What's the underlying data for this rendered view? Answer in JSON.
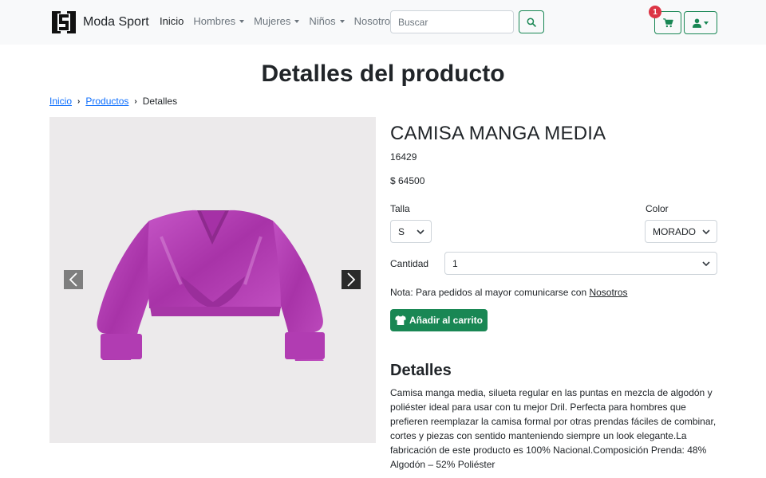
{
  "brand": {
    "name": "Moda Sport"
  },
  "nav": {
    "items": [
      {
        "label": "Inicio",
        "active": true,
        "dropdown": false
      },
      {
        "label": "Hombres",
        "active": false,
        "dropdown": true
      },
      {
        "label": "Mujeres",
        "active": false,
        "dropdown": true
      },
      {
        "label": "Niños",
        "active": false,
        "dropdown": true
      },
      {
        "label": "Nosotros",
        "active": false,
        "dropdown": false
      }
    ],
    "search_placeholder": "Buscar",
    "cart_count": "1"
  },
  "page": {
    "title": "Detalles del producto"
  },
  "breadcrumb": {
    "home": "Inicio",
    "products": "Productos",
    "current": "Detalles"
  },
  "product": {
    "name": "CAMISA MANGA MEDIA",
    "ref": "16429",
    "price": "$ 64500",
    "size_label": "Talla",
    "size_value": "S",
    "color_label": "Color",
    "color_value": "MORADO",
    "qty_label": "Cantidad",
    "qty_value": "1",
    "note_text": "Nota: Para pedidos al mayor comunicarse con ",
    "note_link": "Nosotros",
    "add_button": "Añadir al carrito",
    "details_title": "Detalles",
    "details_text": "Camisa manga media, silueta regular en las puntas en mezcla de algodón y poliéster ideal para usar con tu mejor Dril. Perfecta para hombres que prefieren reemplazar la camisa formal por otras prendas fáciles de combinar, cortes y piezas con sentido manteniendo siempre un look elegante.La fabricación de este producto es 100% Nacional.Composición Prenda:  48% Algodón – 52% Poliéster"
  },
  "colors": {
    "accent": "#198754",
    "badge": "#dc3545",
    "link": "#0d6efd",
    "navbar_bg": "#f8f9fa",
    "garment": "#b43fb4"
  },
  "icons": {
    "search": "search-icon",
    "cart": "cart-icon",
    "user": "user-icon",
    "shirt": "shirt-icon",
    "prev": "chevron-left-icon",
    "next": "chevron-right-icon"
  }
}
